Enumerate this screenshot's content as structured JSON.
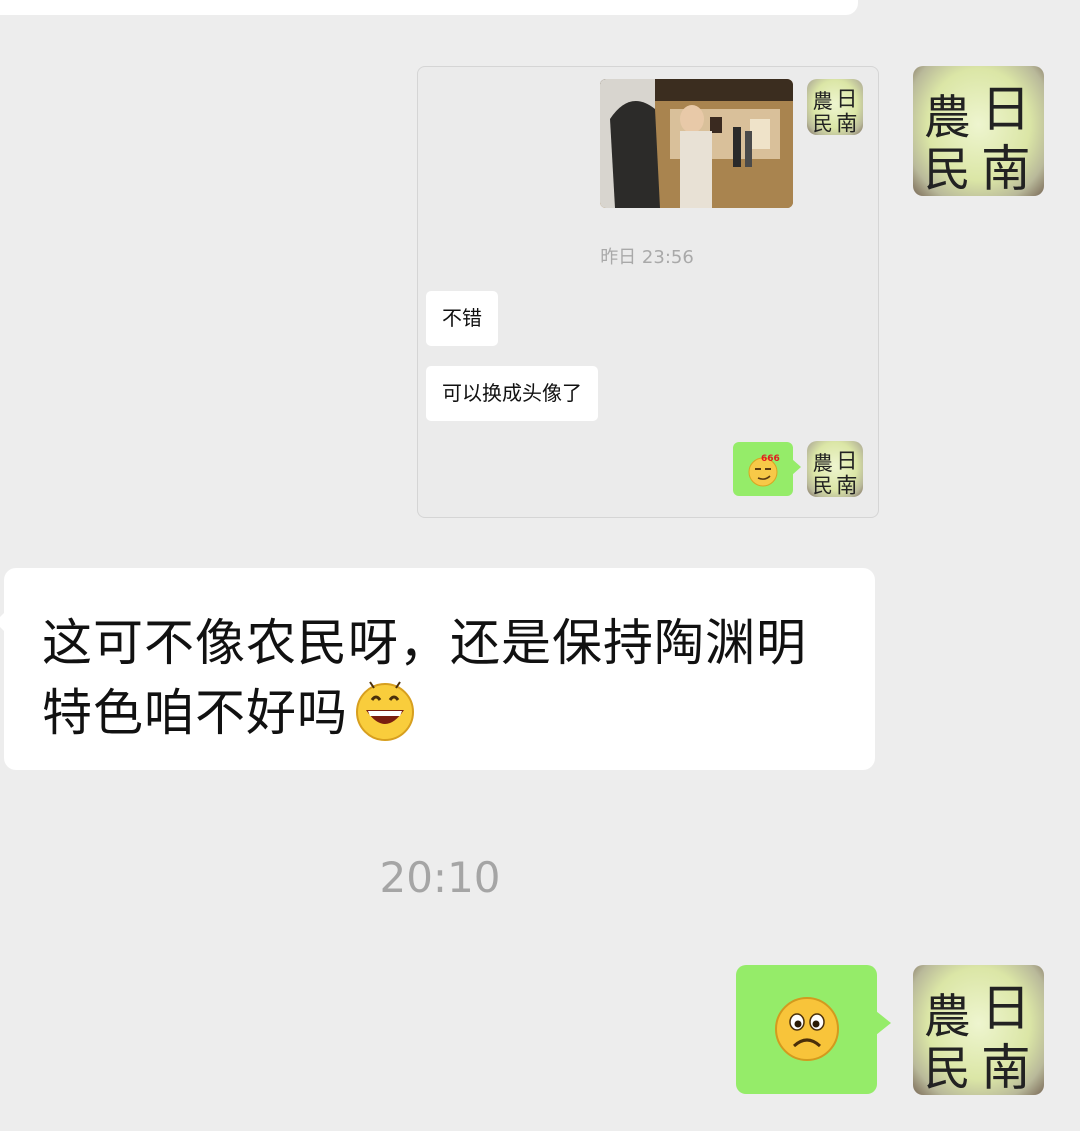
{
  "quote": {
    "timestamp": "昨日 23:56",
    "messages": [
      {
        "text": "不错"
      },
      {
        "text": "可以换成头像了"
      }
    ],
    "sticker_text": "666",
    "avatar_text": "農民日南"
  },
  "main_message": {
    "text": "这可不像农民呀，还是保持陶渊明特色咱不好吗",
    "emoji": "grinning-face"
  },
  "time_divider": "20:10",
  "last_message": {
    "emoji": "frowning-face"
  },
  "colors": {
    "background": "#ededed",
    "bubble_incoming": "#ffffff",
    "bubble_outgoing": "#95ec69",
    "timestamp": "#a5a5a5"
  }
}
